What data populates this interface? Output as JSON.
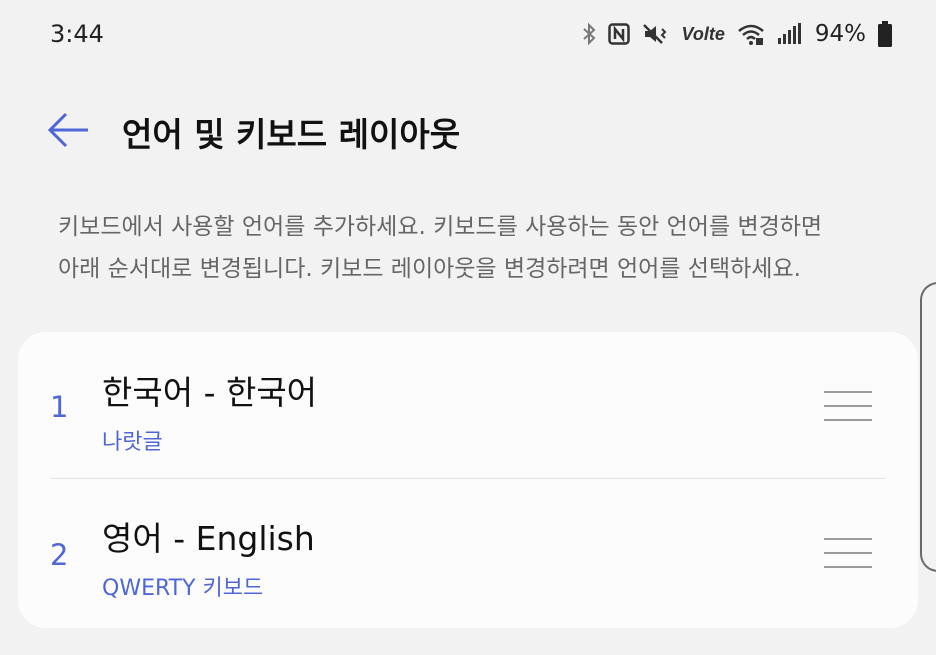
{
  "status_bar": {
    "time": "3:44",
    "volte_label": "Volte",
    "battery_percent": "94%",
    "icons": [
      "bluetooth-icon",
      "nfc-icon",
      "vibrate-icon",
      "volte-icon",
      "wifi-icon",
      "signal-icon",
      "battery-icon"
    ]
  },
  "header": {
    "back_icon": "arrow-left-icon",
    "title": "언어 및 키보드 레이아웃"
  },
  "description": {
    "line1": "키보드에서 사용할 언어를 추가하세요. 키보드를 사용하는 동안 언어를 변경하면",
    "line2": "아래 순서대로 변경됩니다. 키보드 레이아웃을 변경하려면 언어를 선택하세요."
  },
  "languages": [
    {
      "index": "1",
      "name": "한국어 - 한국어",
      "layout": "나랏글"
    },
    {
      "index": "2",
      "name": "영어 - English",
      "layout": "QWERTY 키보드"
    }
  ],
  "colors": {
    "background": "#f2f2f2",
    "card": "#fcfcfc",
    "accent": "#4f67d6",
    "description_text": "#666666"
  }
}
